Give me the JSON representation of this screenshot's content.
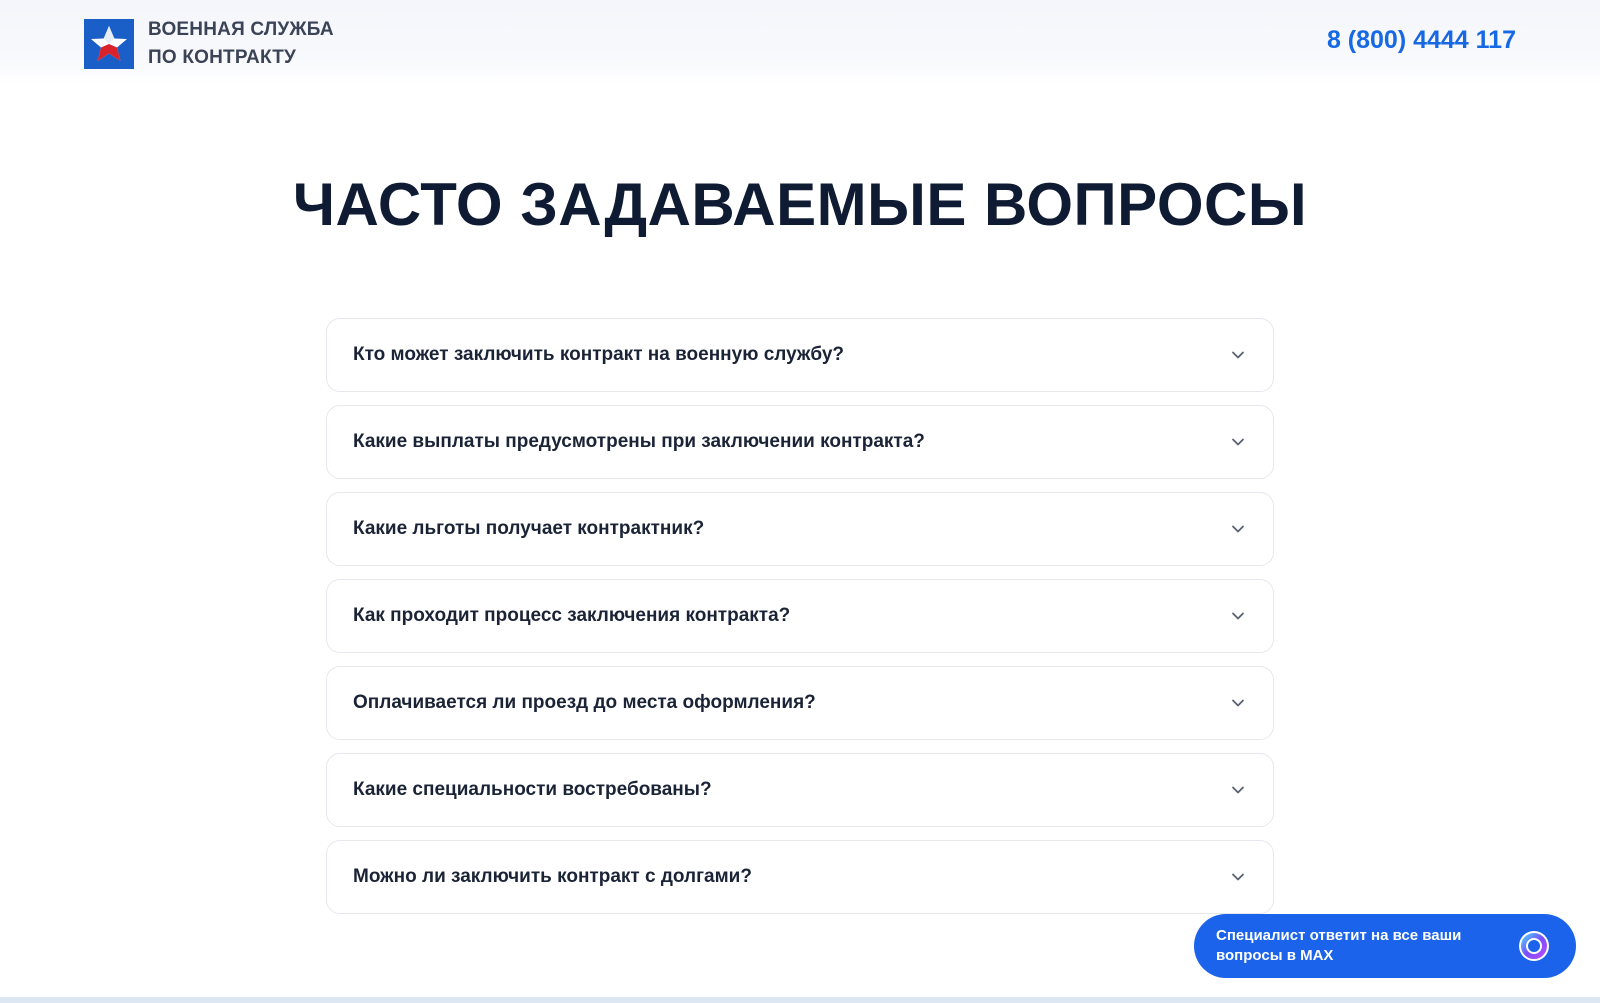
{
  "header": {
    "logo_line1": "ВОЕННАЯ СЛУЖБА",
    "logo_line2": "ПО КОНТРАКТУ",
    "phone": "8 (800) 4444 117"
  },
  "title": "ЧАСТО ЗАДАВАЕМЫЕ ВОПРОСЫ",
  "faq": [
    {
      "question": "Кто может заключить контракт на военную службу?"
    },
    {
      "question": "Какие выплаты предусмотрены при заключении контракта?"
    },
    {
      "question": "Какие льготы получает контрактник?"
    },
    {
      "question": "Как проходит процесс заключения контракта?"
    },
    {
      "question": "Оплачивается ли проезд до места оформления?"
    },
    {
      "question": "Какие специальности востребованы?"
    },
    {
      "question": "Можно ли заключить контракт с долгами?"
    }
  ],
  "chat": {
    "line1": "Специалист ответит на все ваши",
    "line2": "вопросы в MAX"
  },
  "colors": {
    "accent": "#1a63ea",
    "phone": "#1668e3",
    "title": "#0f1b33",
    "logo_bg": "#1a5fc8",
    "star_red": "#d8232a"
  },
  "icons": {
    "logo": "star-emblem-icon",
    "faq_toggle": "chevron-down-icon",
    "chat": "max-messenger-icon"
  }
}
